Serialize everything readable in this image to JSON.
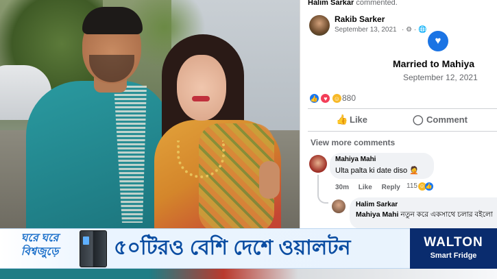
{
  "facebook": {
    "notification": {
      "user": "Halim Sarkar",
      "action": "commented."
    },
    "post": {
      "author": "Rakib Sarker",
      "date": "September 13, 2021",
      "meta": "· ⚙ · 🌐",
      "event_icon": "heart-icon",
      "event_title": "Married to Mahiya",
      "event_date": "September 12, 2021"
    },
    "reactions": {
      "count": "880",
      "icons": [
        "like-icon",
        "love-icon",
        "care-icon"
      ]
    },
    "actions": {
      "like_label": "Like",
      "comment_label": "Comment"
    },
    "view_more": "View more comments",
    "comments": [
      {
        "author": "Mahiya Mahi",
        "text": "Ulta palta ki date diso 🤦",
        "time": "30m",
        "like_label": "Like",
        "reply_label": "Reply",
        "reaction_count": "115"
      },
      {
        "author": "Halim Sarkar",
        "mention": "Mahiya Mahi",
        "text": "নতুন করে একসাথে চলার বইলো"
      }
    ]
  },
  "ad": {
    "slogan_line1": "ঘরে ঘরে",
    "slogan_line2": "বিশ্বজুড়ে",
    "headline": "৫০টিরও বেশি দেশে ওয়ালটন",
    "brand": "WALTON",
    "brand_sub": "Smart Fridge"
  },
  "colors": {
    "facebook_blue": "#1877f2",
    "text_secondary": "#65676b",
    "bubble_bg": "#f0f2f5",
    "ad_brand_bg": "#0a2c6e",
    "ad_headline": "#0b4da2"
  }
}
